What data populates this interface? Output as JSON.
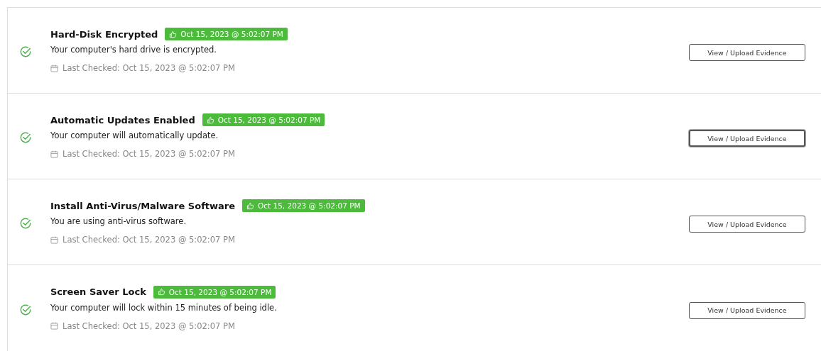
{
  "checks": [
    {
      "title": "Hard-Disk Encrypted",
      "badge": "Oct 15, 2023 @ 5:02:07 PM",
      "description": "Your computer's hard drive is encrypted.",
      "last_checked": "Last Checked: Oct 15, 2023 @ 5:02:07 PM",
      "button": "View / Upload Evidence",
      "focused": false
    },
    {
      "title": "Automatic Updates Enabled",
      "badge": "Oct 15, 2023 @ 5:02:07 PM",
      "description": "Your computer will automatically update.",
      "last_checked": "Last Checked: Oct 15, 2023 @ 5:02:07 PM",
      "button": "View / Upload Evidence",
      "focused": true
    },
    {
      "title": "Install Anti-Virus/Malware Software",
      "badge": "Oct 15, 2023 @ 5:02:07 PM",
      "description": "You are using anti-virus software.",
      "last_checked": "Last Checked: Oct 15, 2023 @ 5:02:07 PM",
      "button": "View / Upload Evidence",
      "focused": false
    },
    {
      "title": "Screen Saver Lock",
      "badge": "Oct 15, 2023 @ 5:02:07 PM",
      "description": "Your computer will lock within 15 minutes of being idle.",
      "last_checked": "Last Checked: Oct 15, 2023 @ 5:02:07 PM",
      "button": "View / Upload Evidence",
      "focused": false
    }
  ]
}
